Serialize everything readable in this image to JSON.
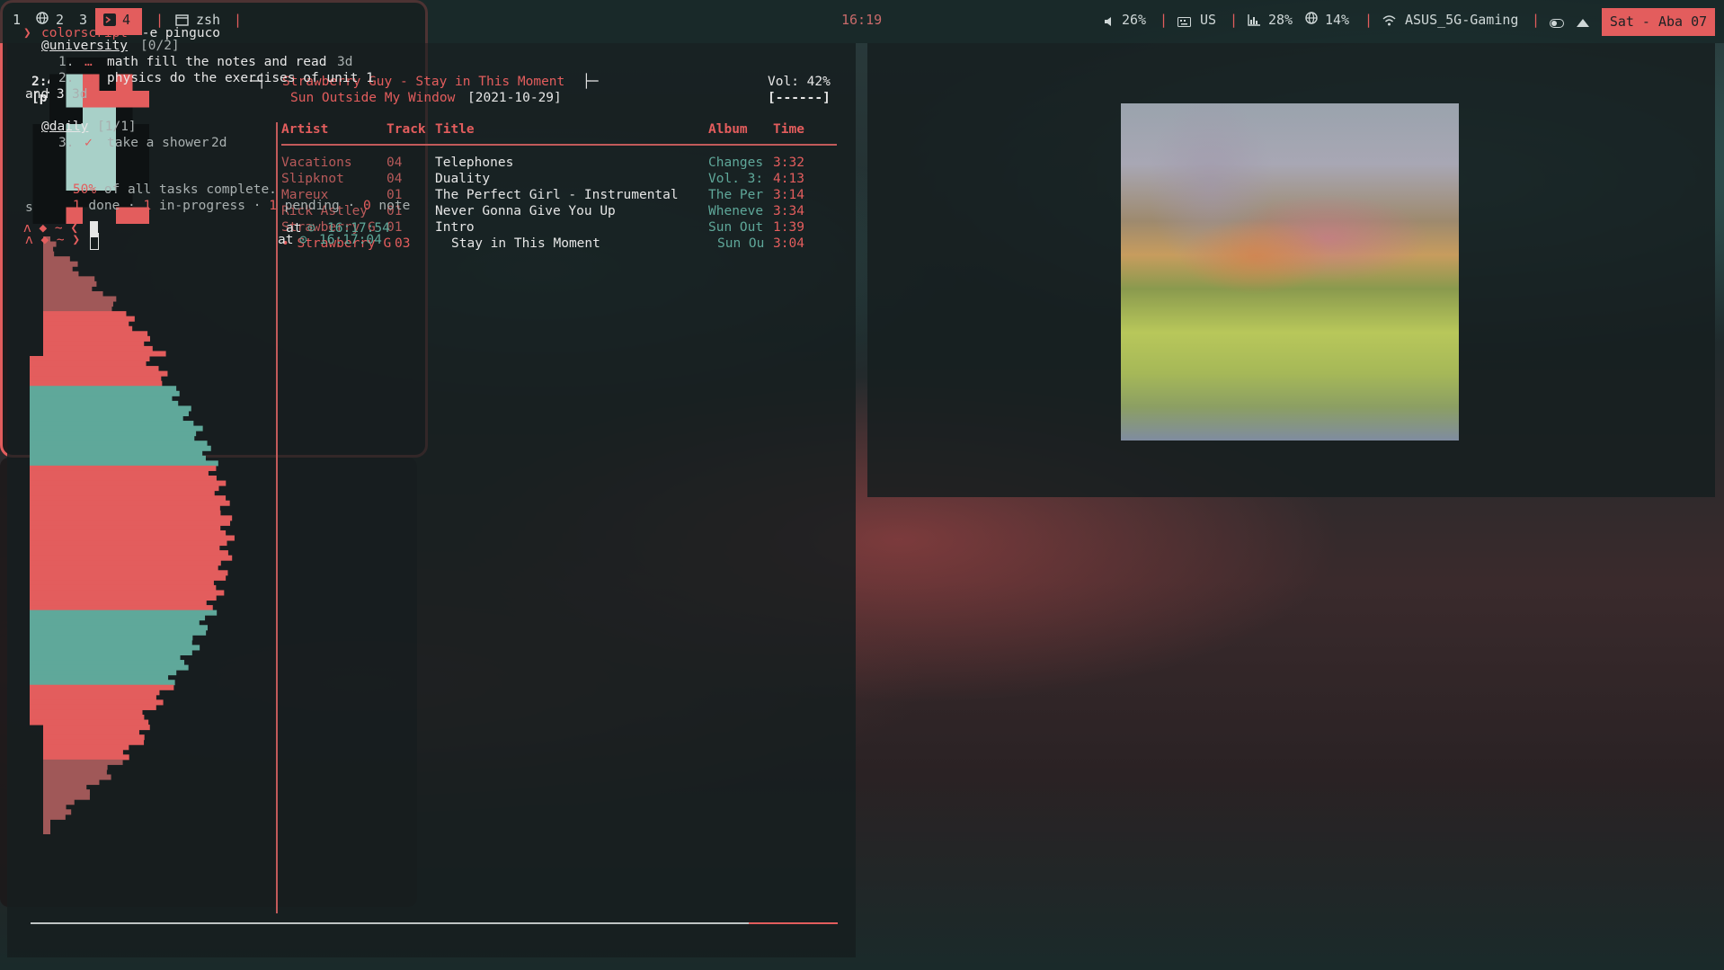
{
  "topbar": {
    "workspaces": [
      "1",
      "2",
      "3",
      "4"
    ],
    "separator": "|",
    "window_title": "zsh",
    "clock": "16:19",
    "volume": "26%",
    "keyboard": "US",
    "cpu": "28%",
    "mem": "14%",
    "wifi": "ASUS_5G-Gaming",
    "date": "Sat - Aba 07",
    "colors": {
      "accent": "#e35d5d",
      "teal": "#5fa89a"
    },
    "icons": [
      "globe-icon",
      "terminal-icon",
      "window-icon",
      "volume-icon",
      "keyboard-icon",
      "cpu-icon",
      "globe-icon",
      "wifi-icon",
      "toggle-icon",
      "arrow-up-icon"
    ]
  },
  "player": {
    "elapsed": "2:44/3:04",
    "state": "[playing]",
    "now_playing": "Strawberry Guy - Stay in This Moment",
    "left_bracket": "─┤",
    "right_bracket": "├─",
    "album": "Sun Outside My Window",
    "date": "[2021-10-29]",
    "volume": "Vol: 42%",
    "volume_bar": "[------]",
    "progress_fraction": 0.89
  },
  "playlist": {
    "headers": {
      "artist": "Artist",
      "track": "Track",
      "title": "Title",
      "album": "Album",
      "time": "Time"
    },
    "rows": [
      {
        "artist": "Vacations",
        "track": "04",
        "title": "Telephones",
        "album": "Changes",
        "time": "3:32"
      },
      {
        "artist": "Slipknot",
        "track": "04",
        "title": "Duality",
        "album": "Vol. 3:",
        "time": "4:13"
      },
      {
        "artist": "Mareux",
        "track": "01",
        "title": "The Perfect Girl - Instrumental",
        "album": "The Per",
        "time": "3:14"
      },
      {
        "artist": "Rick Astley",
        "track": "01",
        "title": "Never Gonna Give You Up",
        "album": "Wheneve",
        "time": "3:34"
      },
      {
        "artist": "Strawberry G",
        "track": "01",
        "title": "Intro",
        "album": "Sun Out",
        "time": "1:39"
      },
      {
        "artist": "• Strawberry G",
        "track": "03",
        "title": "Stay in This Moment",
        "album": "Sun Ou",
        "time": "3:04"
      }
    ]
  },
  "term1": {
    "prompt_arrow": "❯",
    "command": "colorscript",
    "args": " -e pinguco",
    "prompt_line": "ʌ ◆ ~ ❮",
    "at": "at",
    "time": "16:17:54"
  },
  "term2": {
    "lines": [
      {
        "tag": "@university",
        "count": "[0/2]"
      },
      {
        "num": "1.",
        "mark": "…",
        "text": "math fill the notes and read",
        "age": "3d"
      },
      {
        "num": "2.",
        "mark": "□",
        "text": "physics do the exercises of unit 1",
        "wrap": "and 3",
        "age": "3d"
      },
      {
        "tag": "@daily",
        "count": "[1/1]"
      },
      {
        "num": "3.",
        "mark": "✓",
        "text": "take a shower",
        "age": "2d"
      }
    ],
    "summary_pct": "50%",
    "summary_text": " of all tasks complete.",
    "done_n": "1",
    "done": " done · ",
    "inprog_n": "1",
    "inprog": " in-progress · ",
    "pending_n": "1",
    "pending": " pending · ",
    "notes_n": "0",
    "notes": " note",
    "notes_wrap": "s",
    "prompt_line": "ʌ ◆ ~ ❯",
    "at": "at",
    "time": "16:17:04"
  },
  "visualizer": {
    "colors": [
      "#e35d5d",
      "#5fa89a",
      "#a05858"
    ]
  }
}
